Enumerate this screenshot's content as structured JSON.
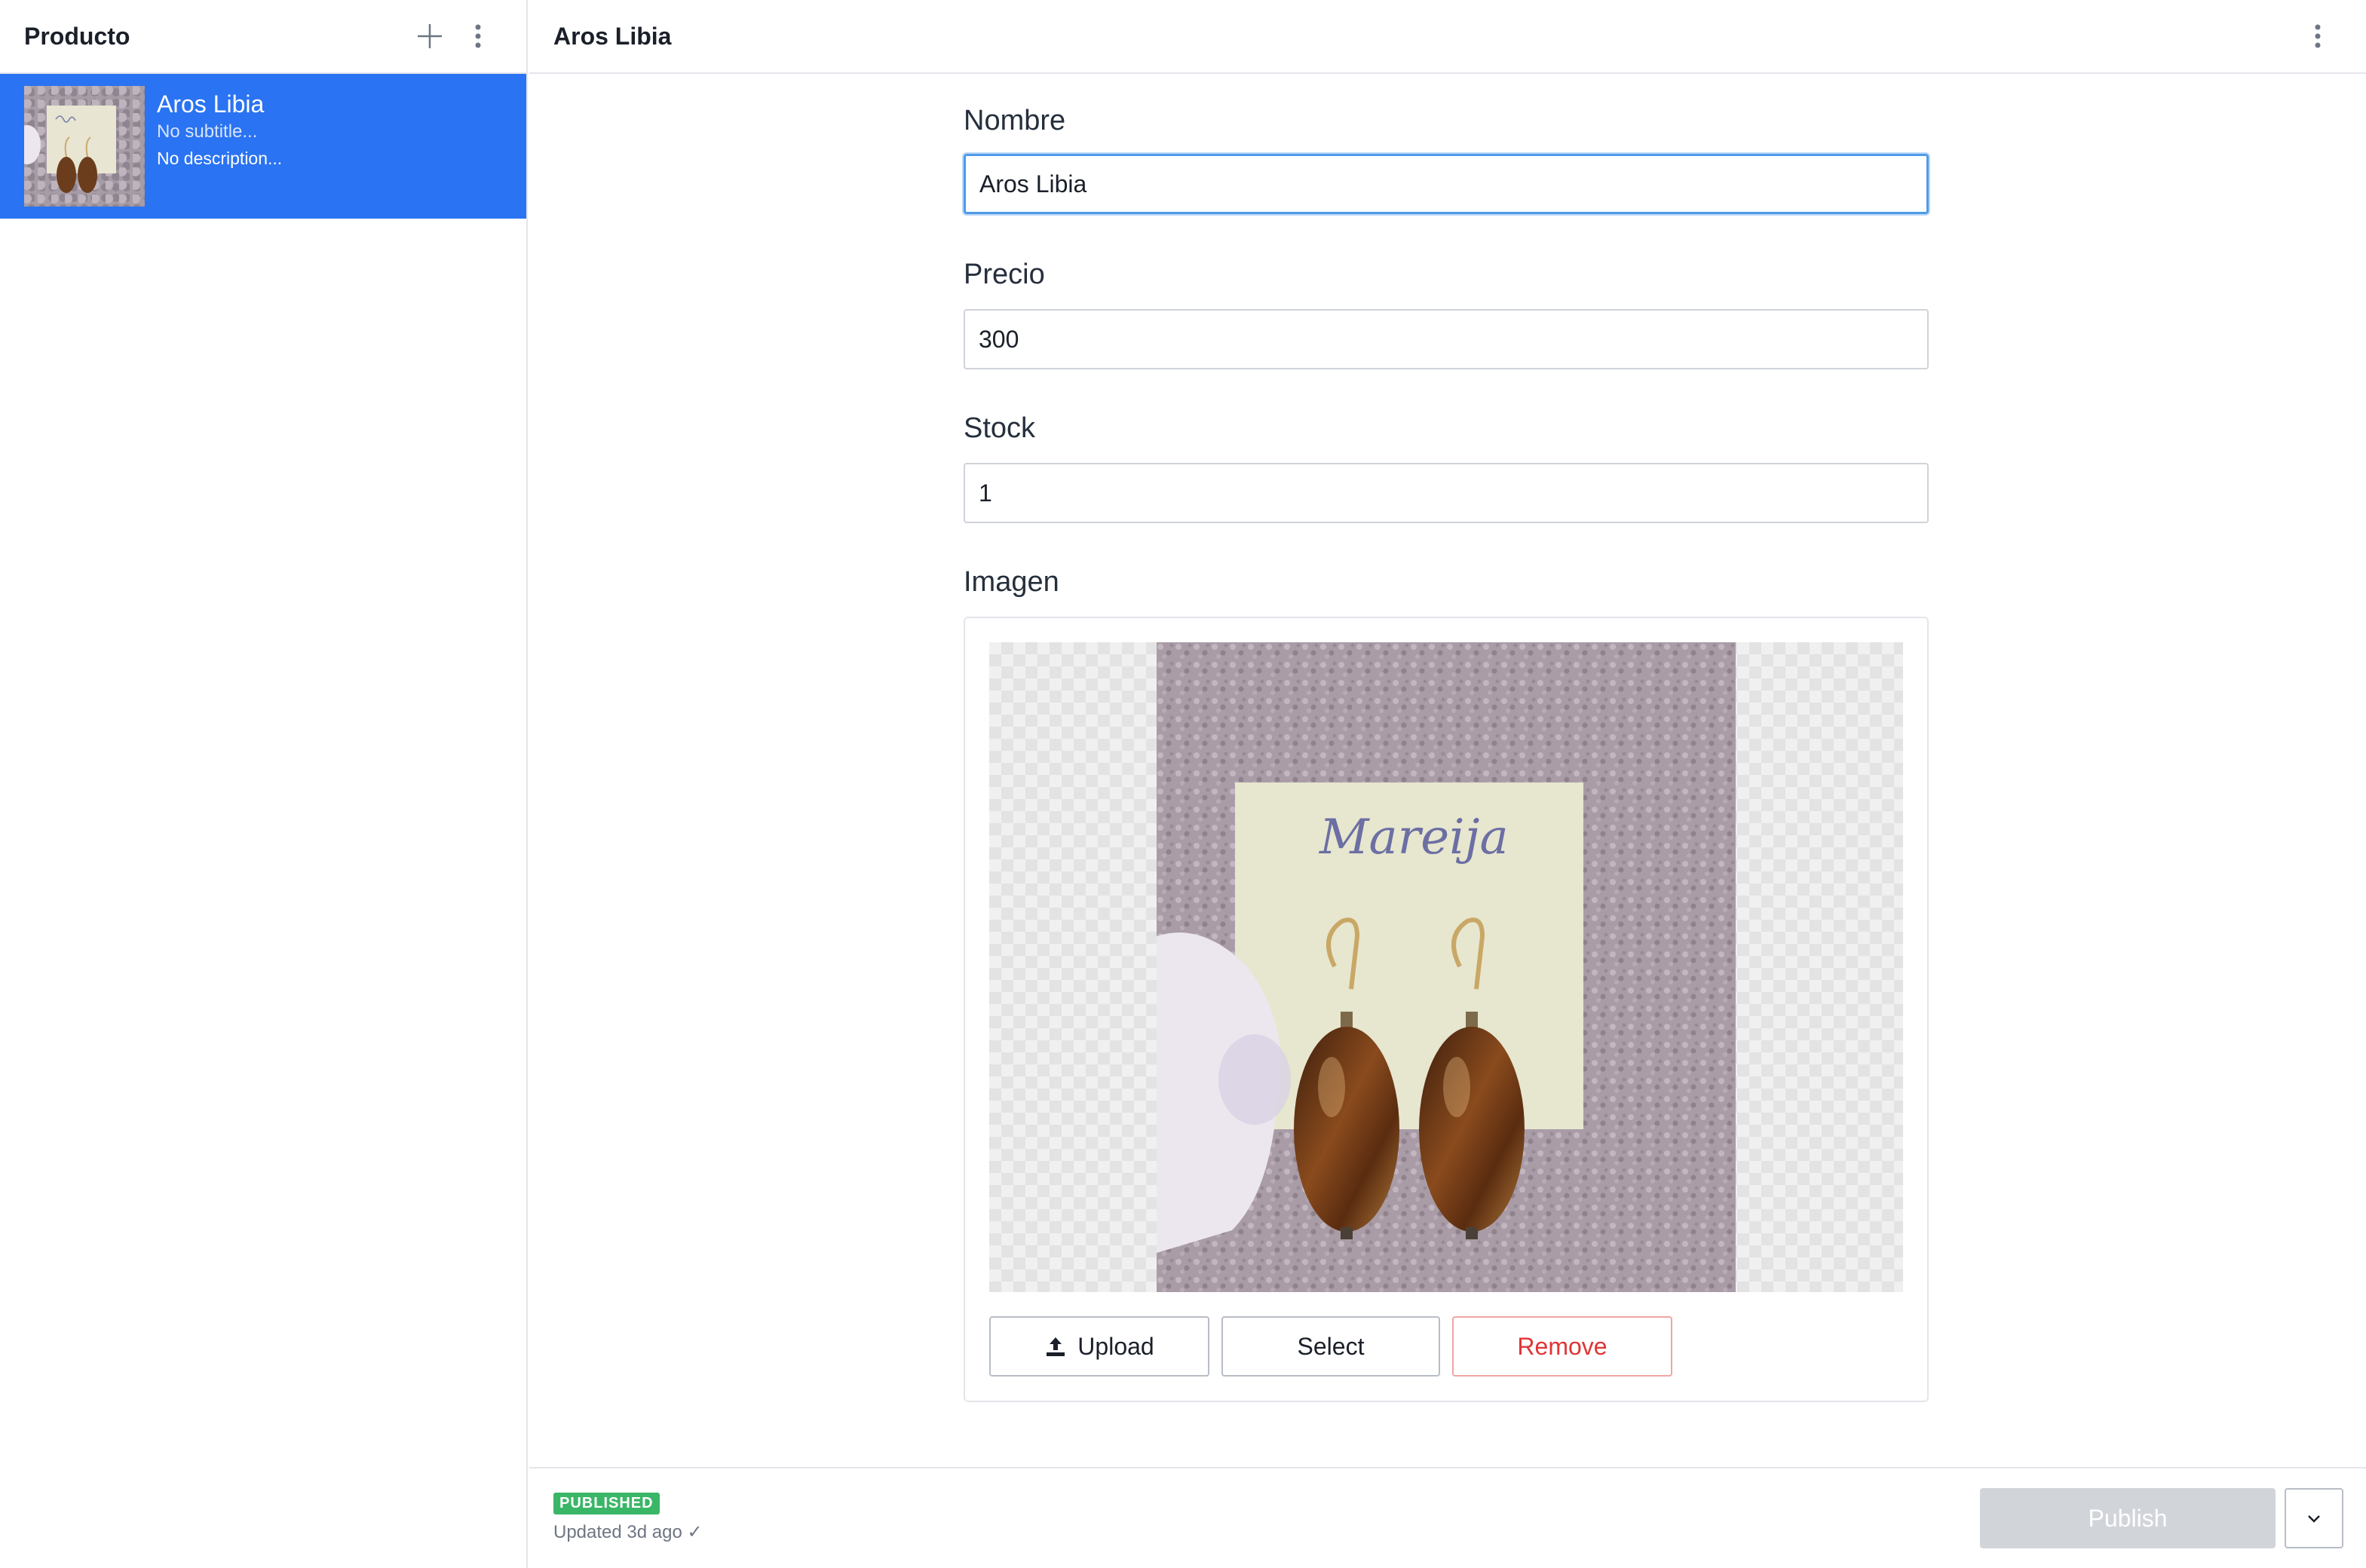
{
  "sidebar": {
    "title": "Producto",
    "icons": {
      "add": "plus-icon",
      "menu": "kebab-menu-icon"
    },
    "items": [
      {
        "title": "Aros Libia",
        "subtitle": "No subtitle...",
        "description": "No description..."
      }
    ]
  },
  "document": {
    "title": "Aros Libia",
    "menu_icon": "kebab-menu-icon"
  },
  "form": {
    "nombre": {
      "label": "Nombre",
      "value": "Aros Libia"
    },
    "precio": {
      "label": "Precio",
      "value": "300"
    },
    "stock": {
      "label": "Stock",
      "value": "1"
    },
    "imagen": {
      "label": "Imagen",
      "photo_text": "Mareija",
      "upload_label": "Upload",
      "select_label": "Select",
      "remove_label": "Remove"
    }
  },
  "footer": {
    "status_badge": "PUBLISHED",
    "updated_text": "Updated 3d ago ✓",
    "publish_label": "Publish",
    "menu_icon": "chevron-down-icon"
  },
  "colors": {
    "accent": "#2a73f2",
    "published": "#3ab667",
    "remove": "#e13535",
    "focus": "#4f9be8"
  }
}
